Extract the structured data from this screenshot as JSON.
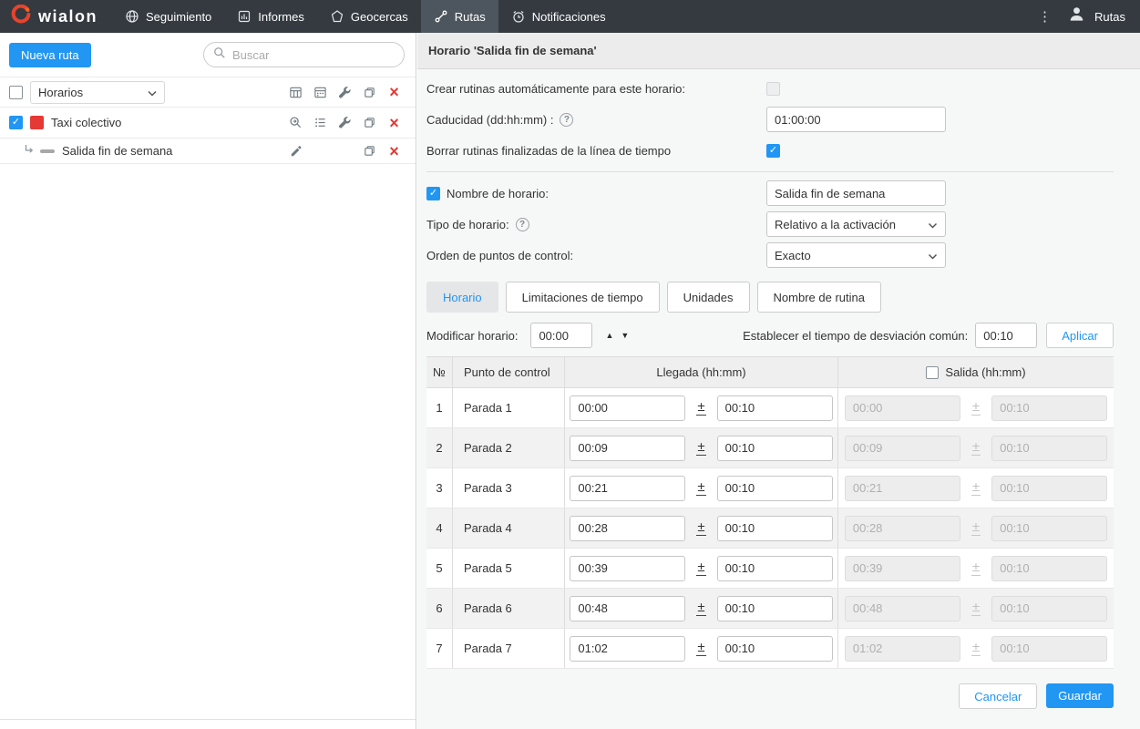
{
  "icons": {
    "check": "✓",
    "close": "×",
    "plus_minus": "±",
    "up_arrow": "▲",
    "down_arrow": "▼",
    "question": "?",
    "kebab": "⋮"
  },
  "topbar": {
    "logo_text": "wialon",
    "nav": [
      {
        "label": "Seguimiento",
        "icon": "globe",
        "active": false
      },
      {
        "label": "Informes",
        "icon": "report-chart",
        "active": false
      },
      {
        "label": "Geocercas",
        "icon": "geofence-polygon",
        "active": false
      },
      {
        "label": "Rutas",
        "icon": "route",
        "active": true
      },
      {
        "label": "Notificaciones",
        "icon": "alarm",
        "active": false
      }
    ],
    "user_menu_label": "Rutas"
  },
  "sidebar": {
    "new_route_button": "Nueva ruta",
    "search_placeholder": "Buscar",
    "list_type_dropdown": "Horarios",
    "list_type_checked": false,
    "route_name": "Taxi colectivo",
    "route_checked": true,
    "route_color": "#e53935",
    "schedule_name": "Salida fin de semana"
  },
  "main": {
    "header_title": "Horario 'Salida fin de semana'",
    "form": {
      "auto_routines_label": "Crear rutinas automáticamente para este horario:",
      "auto_routines_checked": false,
      "expiration_label": "Caducidad (dd:hh:mm) :",
      "expiration_value": "01:00:00",
      "remove_finished_label": "Borrar rutinas finalizadas de la línea de tiempo",
      "remove_finished_checked": true,
      "name_label": "Nombre de horario:",
      "name_checked": true,
      "name_value": "Salida fin de semana",
      "type_label": "Tipo de horario:",
      "type_value": "Relativo a la activación",
      "order_label": "Orden de puntos de control:",
      "order_value": "Exacto"
    },
    "tabs": [
      {
        "label": "Horario",
        "active": true
      },
      {
        "label": "Limitaciones de tiempo",
        "active": false
      },
      {
        "label": "Unidades",
        "active": false
      },
      {
        "label": "Nombre de rutina",
        "active": false
      }
    ],
    "modify": {
      "label": "Modificar horario:",
      "value": "00:00",
      "deviation_label": "Establecer el tiempo de desviación común:",
      "deviation_value": "00:10",
      "apply_label": "Aplicar"
    },
    "table": {
      "col_num": "№",
      "col_point": "Punto de control",
      "col_arrival": "Llegada (hh:mm)",
      "col_departure": "Salida (hh:mm)",
      "departure_checked": false,
      "rows": [
        {
          "num": "1",
          "point": "Parada 1",
          "arrival": "00:00",
          "arrival_deviation": "00:10",
          "departure": "00:00",
          "departure_deviation": "00:10"
        },
        {
          "num": "2",
          "point": "Parada 2",
          "arrival": "00:09",
          "arrival_deviation": "00:10",
          "departure": "00:09",
          "departure_deviation": "00:10"
        },
        {
          "num": "3",
          "point": "Parada 3",
          "arrival": "00:21",
          "arrival_deviation": "00:10",
          "departure": "00:21",
          "departure_deviation": "00:10"
        },
        {
          "num": "4",
          "point": "Parada 4",
          "arrival": "00:28",
          "arrival_deviation": "00:10",
          "departure": "00:28",
          "departure_deviation": "00:10"
        },
        {
          "num": "5",
          "point": "Parada 5",
          "arrival": "00:39",
          "arrival_deviation": "00:10",
          "departure": "00:39",
          "departure_deviation": "00:10"
        },
        {
          "num": "6",
          "point": "Parada 6",
          "arrival": "00:48",
          "arrival_deviation": "00:10",
          "departure": "00:48",
          "departure_deviation": "00:10"
        },
        {
          "num": "7",
          "point": "Parada 7",
          "arrival": "01:02",
          "arrival_deviation": "00:10",
          "departure": "01:02",
          "departure_deviation": "00:10"
        }
      ]
    },
    "footer": {
      "cancel_label": "Cancelar",
      "save_label": "Guardar"
    }
  }
}
